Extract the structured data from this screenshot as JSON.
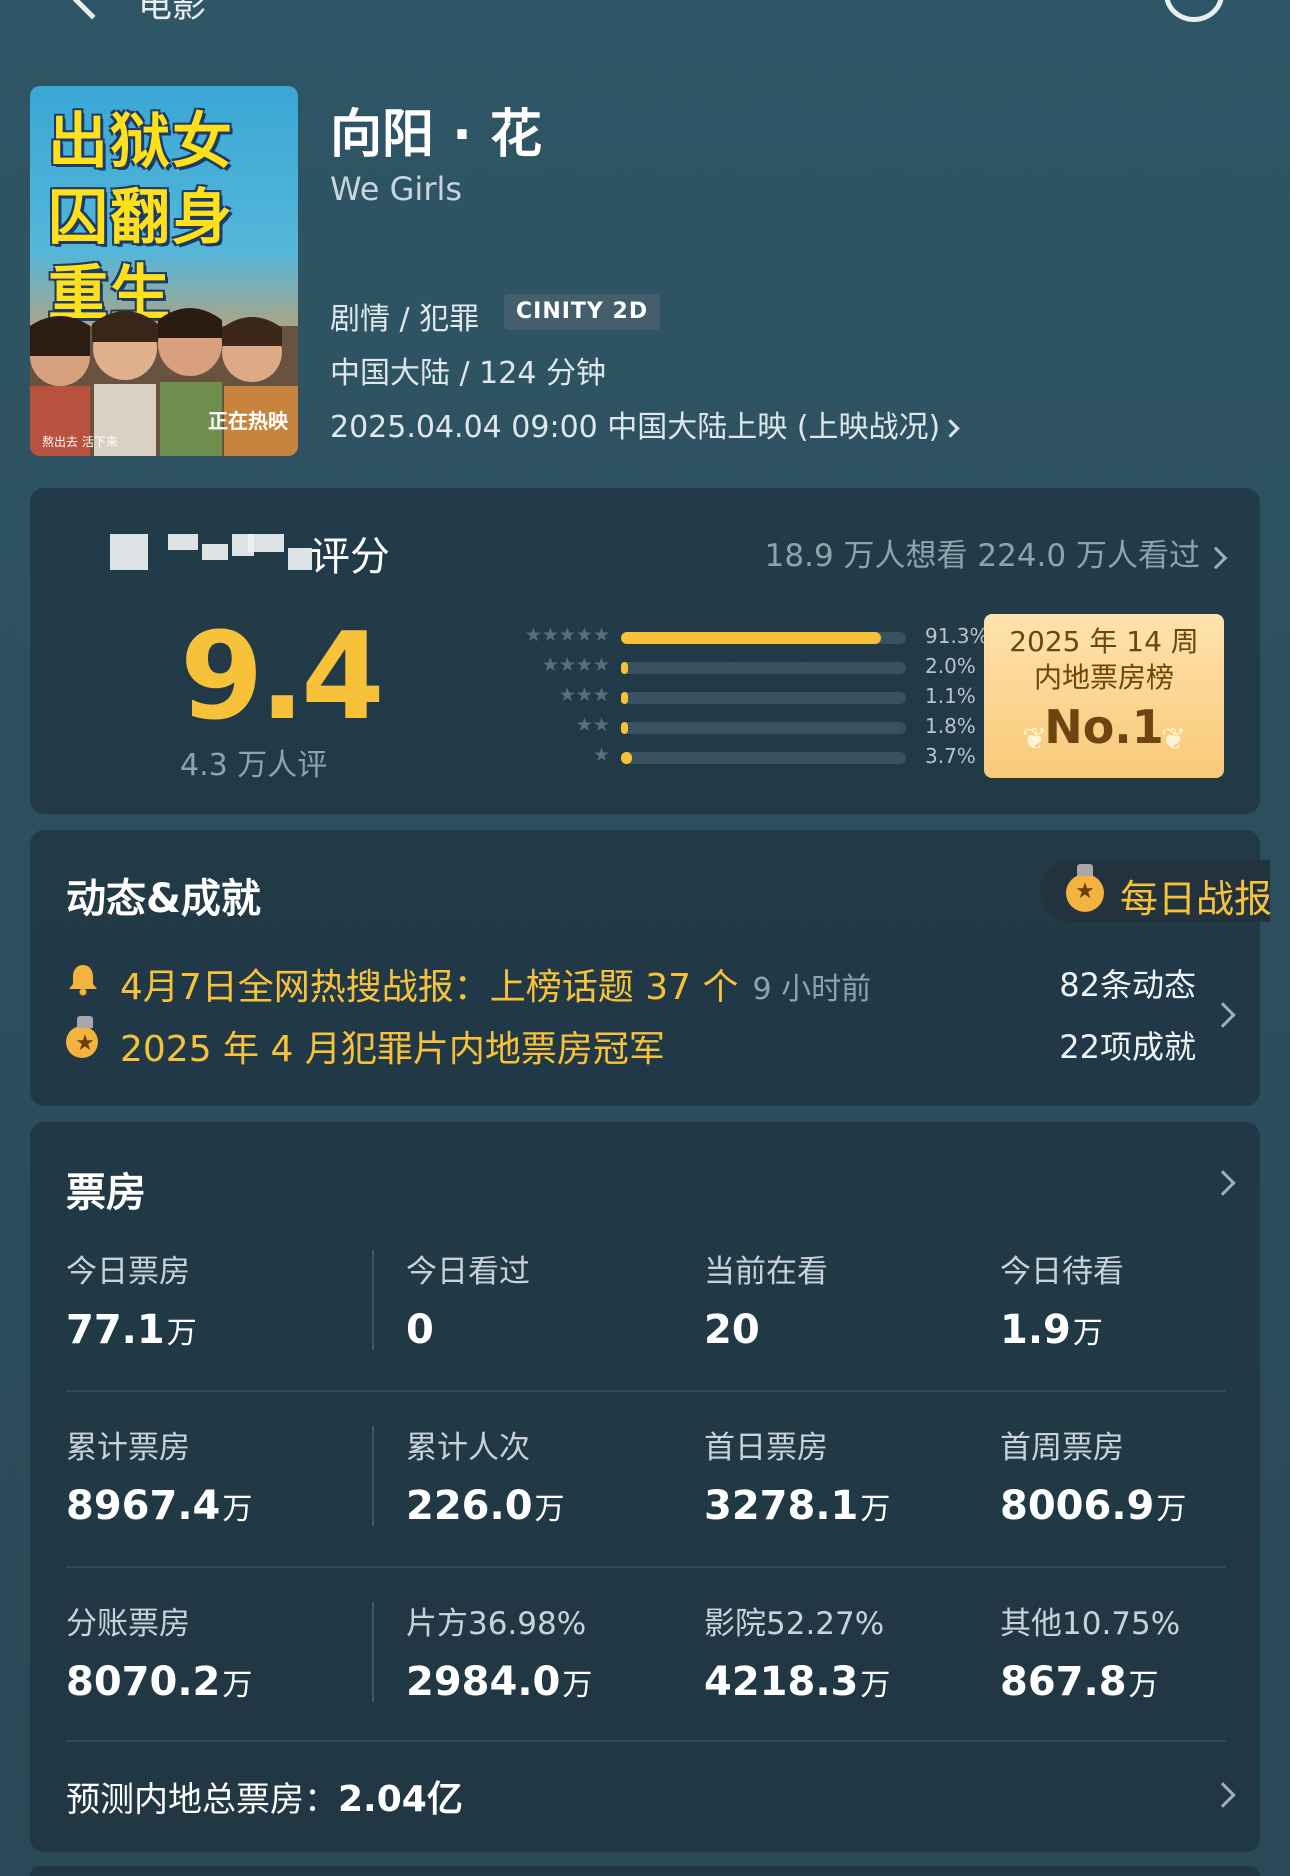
{
  "nav": {
    "title": "电影"
  },
  "movie": {
    "poster": {
      "title": "出狱女囚翻身重生",
      "badge": "正在热映",
      "tagline": "熬出去 活下来"
    },
    "title": "向阳 · 花",
    "subtitle": "We Girls",
    "genre": "剧情 / 犯罪",
    "format": "CINITY 2D",
    "region_runtime": "中国大陆 / 124 分钟",
    "release": "2025.04.04 09:00 中国大陆上映 (上映战况)"
  },
  "rating": {
    "label": "评分",
    "stats": "18.9 万人想看  224.0 万人看过",
    "score": "9.4",
    "count": "4.3 万人评",
    "distribution": [
      {
        "stars": "★★★★★",
        "pct_text": "91.3%",
        "pct": 91.3
      },
      {
        "stars": "★★★★",
        "pct_text": "2.0%",
        "pct": 2.0
      },
      {
        "stars": "★★★",
        "pct_text": "1.1%",
        "pct": 1.1
      },
      {
        "stars": "★★",
        "pct_text": "1.8%",
        "pct": 1.8
      },
      {
        "stars": "★",
        "pct_text": "3.7%",
        "pct": 3.7
      }
    ],
    "rank": {
      "line1": "2025 年 14 周",
      "line2": "内地票房榜",
      "no": "No.1"
    }
  },
  "dynamics": {
    "title": "动态&成就",
    "daily_report": "每日战报",
    "item1": "4月7日全网热搜战报：上榜话题 37 个",
    "item1_time": "9 小时前",
    "item2": "2025 年 4 月犯罪片内地票房冠军",
    "count_dynamic": "82条动态",
    "count_achievement": "22项成就"
  },
  "boxoffice": {
    "title": "票房",
    "rows": [
      [
        {
          "label": "今日票房",
          "value": "77.1",
          "unit": "万"
        },
        {
          "label": "今日看过",
          "value": "0",
          "unit": ""
        },
        {
          "label": "当前在看",
          "value": "20",
          "unit": ""
        },
        {
          "label": "今日待看",
          "value": "1.9",
          "unit": "万"
        }
      ],
      [
        {
          "label": "累计票房",
          "value": "8967.4",
          "unit": "万"
        },
        {
          "label": "累计人次",
          "value": "226.0",
          "unit": "万"
        },
        {
          "label": "首日票房",
          "value": "3278.1",
          "unit": "万"
        },
        {
          "label": "首周票房",
          "value": "8006.9",
          "unit": "万"
        }
      ],
      [
        {
          "label": "分账票房",
          "value": "8070.2",
          "unit": "万"
        },
        {
          "label": "片方36.98%",
          "value": "2984.0",
          "unit": "万"
        },
        {
          "label": "影院52.27%",
          "value": "4218.3",
          "unit": "万"
        },
        {
          "label": "其他10.75%",
          "value": "867.8",
          "unit": "万"
        }
      ]
    ],
    "forecast_label": "预测内地总票房：",
    "forecast_value": "2.04亿"
  },
  "colors": {
    "accent": "#f7c23a",
    "background": "#2c4f5e",
    "card": "#1c2d38",
    "rank_badge": "#f9c978"
  }
}
